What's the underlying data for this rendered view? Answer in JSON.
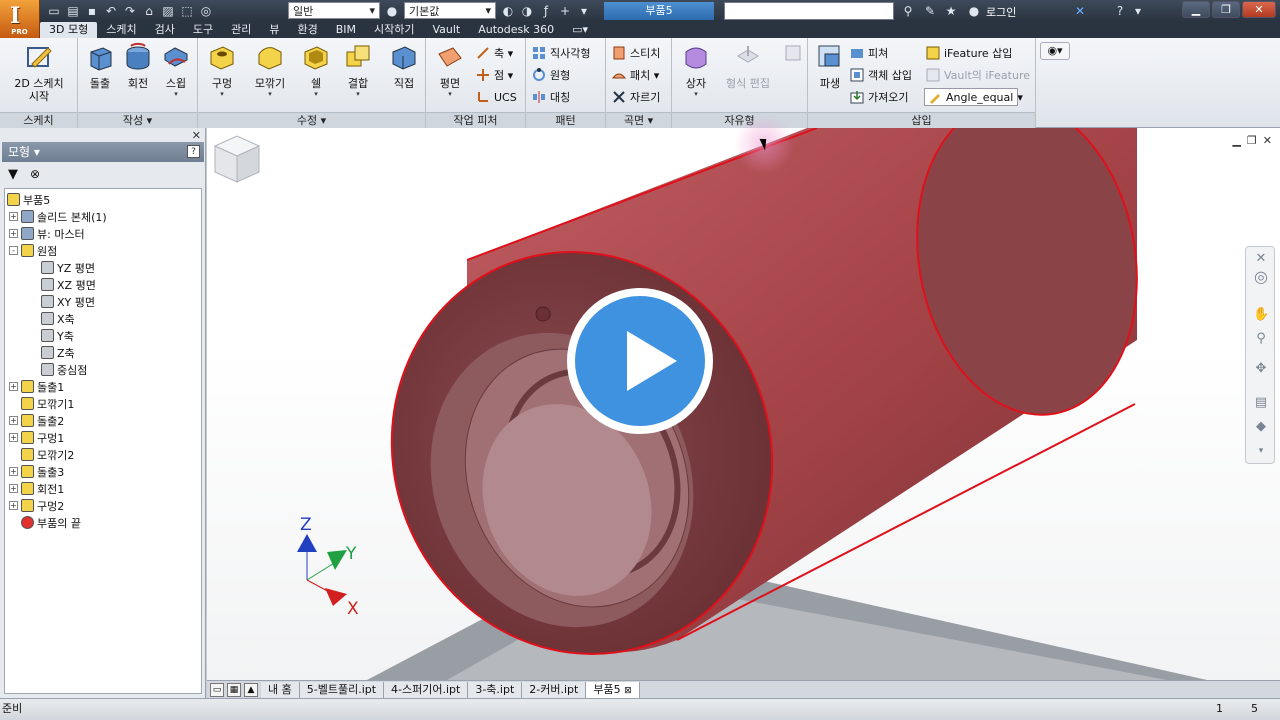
{
  "titlebar": {
    "style_select": "일반",
    "material_select": "기본값",
    "document_title": "부품5",
    "search_placeholder": "",
    "login_label": "로그인",
    "help_label": "?",
    "app_logo_label": "PRO"
  },
  "ribbon_tabs": [
    "3D 모형",
    "스케치",
    "검사",
    "도구",
    "관리",
    "뷰",
    "환경",
    "BIM",
    "시작하기",
    "Vault",
    "Autodesk 360"
  ],
  "active_tab": "3D 모형",
  "ribbon": {
    "sketch_panel": {
      "label": "스케치",
      "buttons": [
        {
          "label1": "2D 스케치",
          "label2": "시작"
        }
      ]
    },
    "create_panel": {
      "label": "작성 ▾",
      "buttons": [
        "돌출",
        "회전",
        "스윕"
      ]
    },
    "modify_panel": {
      "label": "수정 ▾",
      "buttons": [
        "구멍",
        "모깎기",
        "쉘",
        "결합",
        "직접"
      ]
    },
    "work_panel": {
      "label": "작업 피처",
      "buttons": [
        "평면"
      ],
      "small": [
        "축 ▾",
        "점 ▾",
        "UCS"
      ]
    },
    "pattern_panel": {
      "label": "패턴",
      "small": [
        "직사각형",
        "원형",
        "대칭"
      ]
    },
    "surface_panel": {
      "label": "곡면 ▾",
      "small": [
        "스티치",
        "패치 ▾",
        "자르기"
      ]
    },
    "freeform_panel": {
      "label": "자유형",
      "buttons": [
        "상자",
        "형식 편집"
      ]
    },
    "insert_panel": {
      "label": "삽입",
      "buttons": [
        "파생"
      ],
      "small": [
        "피쳐",
        "객체 삽입",
        "가져오기",
        "iFeature 삽입",
        "Vault의 iFeature",
        "Angle_equal"
      ]
    }
  },
  "browser": {
    "title": "모형 ▾",
    "tree": [
      {
        "label": "부품5",
        "level": 0,
        "expander": ""
      },
      {
        "label": "솔리드 본체(1)",
        "level": 1,
        "expander": "+"
      },
      {
        "label": "뷰: 마스터",
        "level": 1,
        "expander": "+"
      },
      {
        "label": "원점",
        "level": 1,
        "expander": "-"
      },
      {
        "label": "YZ 평면",
        "level": 2,
        "expander": ""
      },
      {
        "label": "XZ 평면",
        "level": 2,
        "expander": ""
      },
      {
        "label": "XY 평면",
        "level": 2,
        "expander": ""
      },
      {
        "label": "X축",
        "level": 2,
        "expander": ""
      },
      {
        "label": "Y축",
        "level": 2,
        "expander": ""
      },
      {
        "label": "Z축",
        "level": 2,
        "expander": ""
      },
      {
        "label": "중심점",
        "level": 2,
        "expander": ""
      },
      {
        "label": "돌출1",
        "level": 1,
        "expander": "+"
      },
      {
        "label": "모깎기1",
        "level": 1,
        "expander": ""
      },
      {
        "label": "돌출2",
        "level": 1,
        "expander": "+"
      },
      {
        "label": "구멍1",
        "level": 1,
        "expander": "+"
      },
      {
        "label": "모깎기2",
        "level": 1,
        "expander": ""
      },
      {
        "label": "돌출3",
        "level": 1,
        "expander": "+"
      },
      {
        "label": "회전1",
        "level": 1,
        "expander": "+"
      },
      {
        "label": "구멍2",
        "level": 1,
        "expander": "+"
      },
      {
        "label": "부품의 끝",
        "level": 1,
        "expander": ""
      }
    ]
  },
  "viewport": {
    "axis_labels": {
      "x": "X",
      "y": "Y",
      "z": "Z"
    },
    "colors": {
      "part": "#a9464a",
      "edge": "#e0101a",
      "axis_x": "#d02020",
      "axis_y": "#20a040",
      "axis_z": "#2040c0",
      "play": "#3f92e0"
    }
  },
  "doc_tabs": [
    "내 홈",
    "5-벨트풀리.ipt",
    "4-스퍼기어.ipt",
    "3-축.ipt",
    "2-커버.ipt",
    "부품5"
  ],
  "active_doc_tab": "부품5",
  "statusbar": {
    "text": "준비",
    "count1": "1",
    "count2": "5"
  }
}
